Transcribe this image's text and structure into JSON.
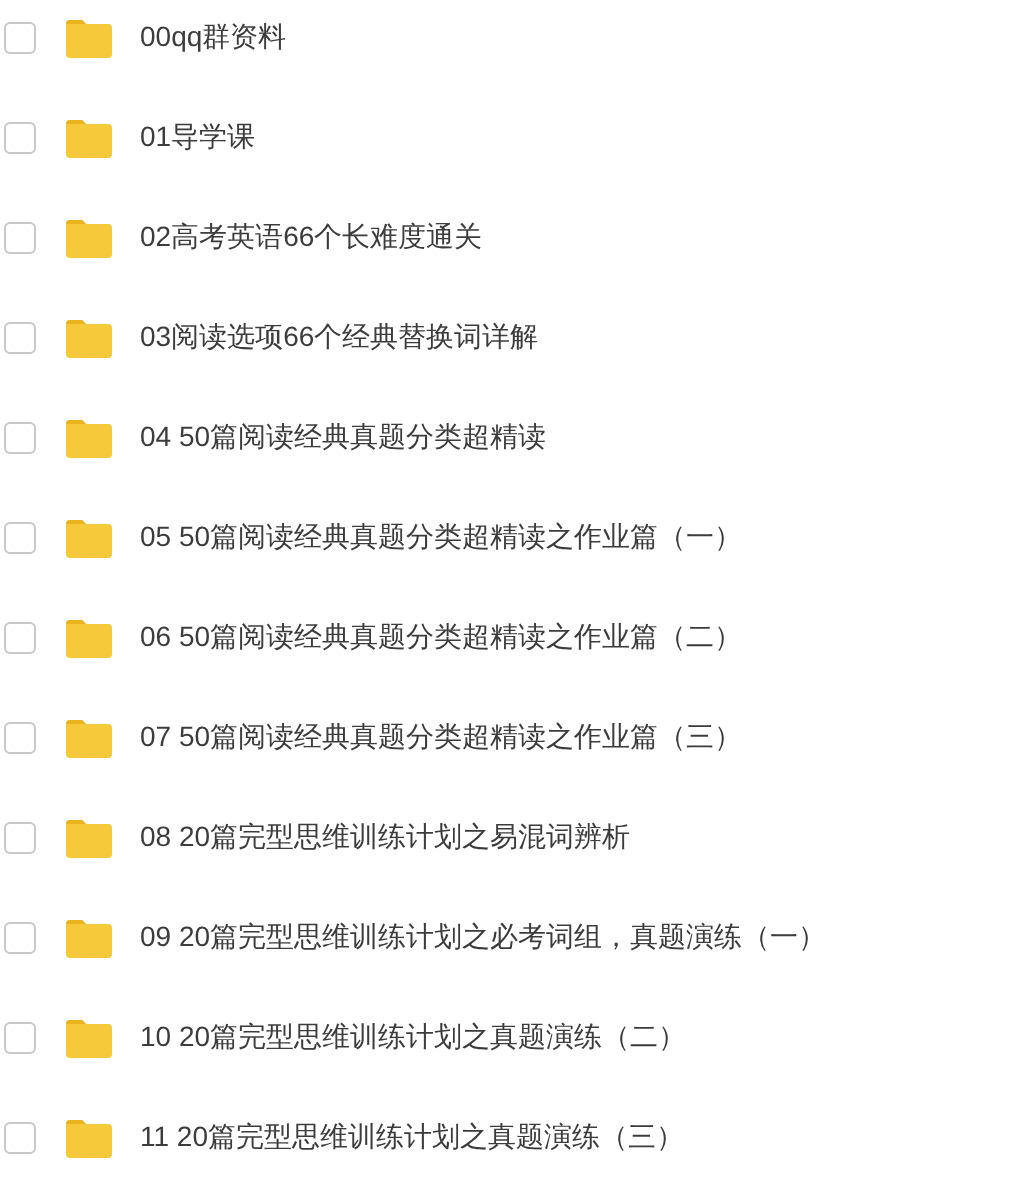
{
  "folders": [
    {
      "name": "00qq群资料",
      "checked": false
    },
    {
      "name": "01导学课",
      "checked": false
    },
    {
      "name": "02高考英语66个长难度通关",
      "checked": false
    },
    {
      "name": "03阅读选项66个经典替换词详解",
      "checked": false
    },
    {
      "name": "04 50篇阅读经典真题分类超精读",
      "checked": false
    },
    {
      "name": "05 50篇阅读经典真题分类超精读之作业篇（一）",
      "checked": false
    },
    {
      "name": "06 50篇阅读经典真题分类超精读之作业篇（二）",
      "checked": false
    },
    {
      "name": "07 50篇阅读经典真题分类超精读之作业篇（三）",
      "checked": false
    },
    {
      "name": "08 20篇完型思维训练计划之易混词辨析",
      "checked": false
    },
    {
      "name": "09 20篇完型思维训练计划之必考词组，真题演练（一）",
      "checked": false
    },
    {
      "name": "10 20篇完型思维训练计划之真题演练（二）",
      "checked": false
    },
    {
      "name": "11 20篇完型思维训练计划之真题演练（三）",
      "checked": false
    }
  ]
}
